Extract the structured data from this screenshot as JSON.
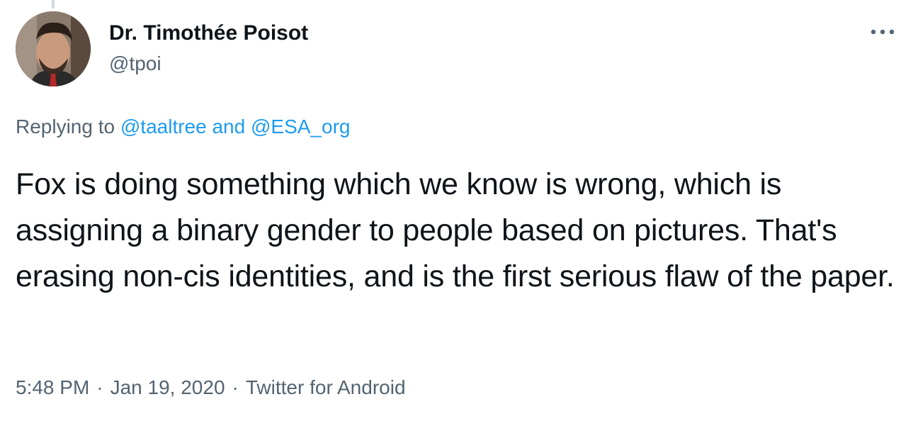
{
  "author": {
    "name": "Dr. Timothée Poisot",
    "handle": "@tpoi"
  },
  "reply": {
    "prefix": "Replying to",
    "mention_1": "@taaltree",
    "connector": "and",
    "mention_2": "@ESA_org"
  },
  "tweet": {
    "text": "Fox is doing something which we know is wrong, which is assigning a binary gender to people based on pictures. That's erasing non-cis identities, and is the first serious flaw of the paper."
  },
  "meta": {
    "time": "5:48 PM",
    "separator": "·",
    "date": "Jan 19, 2020",
    "source": "Twitter for Android"
  },
  "icons": {
    "more": "more-options-icon"
  },
  "colors": {
    "link": "#1d9bf0",
    "secondary_text": "#536471",
    "primary_text": "#0f1419"
  }
}
